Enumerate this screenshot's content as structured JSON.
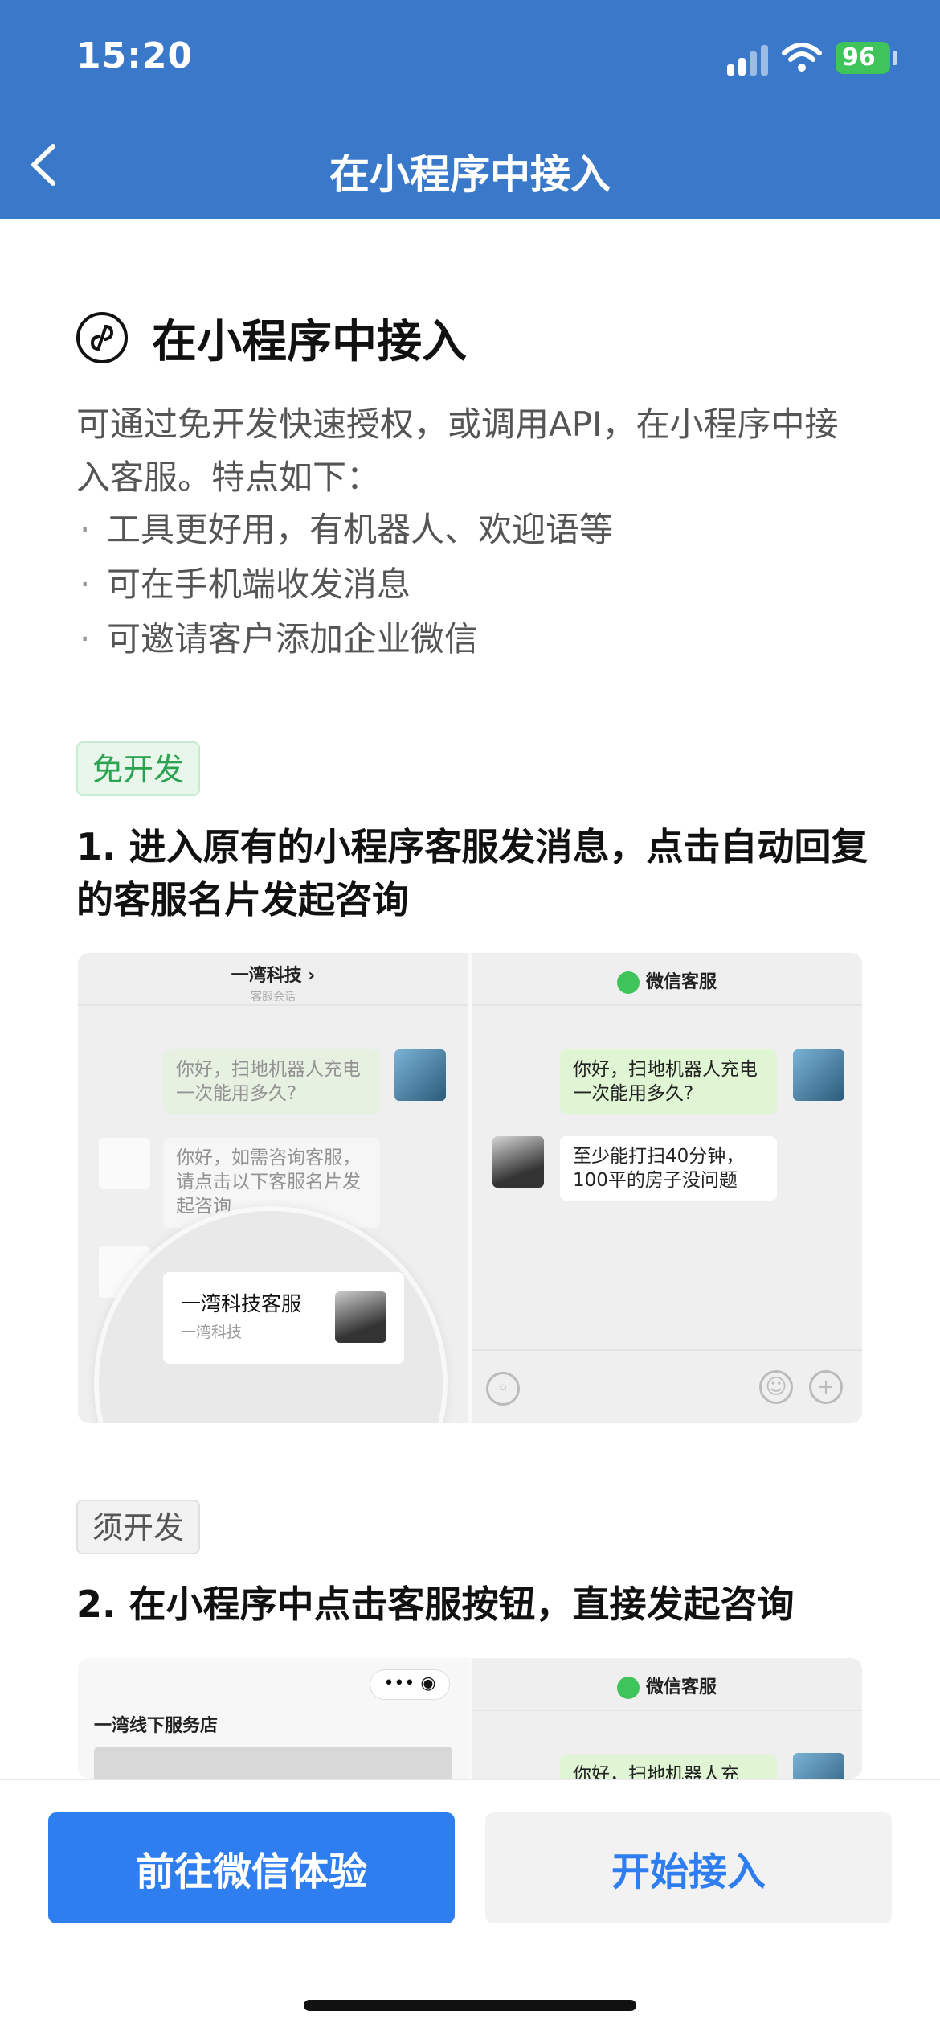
{
  "status_bar": {
    "time": "15:20",
    "battery": "96"
  },
  "nav": {
    "title": "在小程序中接入"
  },
  "content": {
    "title": "在小程序中接入",
    "desc": "可通过免开发快速授权，或调用API，在小程序中接入客服。特点如下：",
    "bullets": [
      "工具更好用，有机器人、欢迎语等",
      "可在手机端收发消息",
      "可邀请客户添加企业微信"
    ],
    "tag1": "免开发",
    "step1": "1. 进入原有的小程序客服发消息，点击自动回复的客服名片发起咨询",
    "tag2": "须开发",
    "step2": "2. 在小程序中点击客服按钮，直接发起咨询"
  },
  "illustration1": {
    "left_title": "一湾科技 ›",
    "left_sub": "客服会话",
    "left_q": "你好，扫地机器人充电一次能用多久?",
    "left_reply": "你好，如需咨询客服，请点击以下客服名片发起咨询",
    "card_name": "一湾科技客服",
    "card_sub": "一湾科技",
    "right_title": "微信客服",
    "right_q": "你好，扫地机器人充电一次能用多久?",
    "right_reply": "至少能打扫40分钟，100平的房子没问题"
  },
  "illustration2": {
    "capsule": "•••  ◉",
    "store_name": "一湾线下服务店",
    "right_title": "微信客服",
    "right_q": "你好，扫地机器人充"
  },
  "buttons": {
    "primary": "前往微信体验",
    "secondary": "开始接入"
  }
}
